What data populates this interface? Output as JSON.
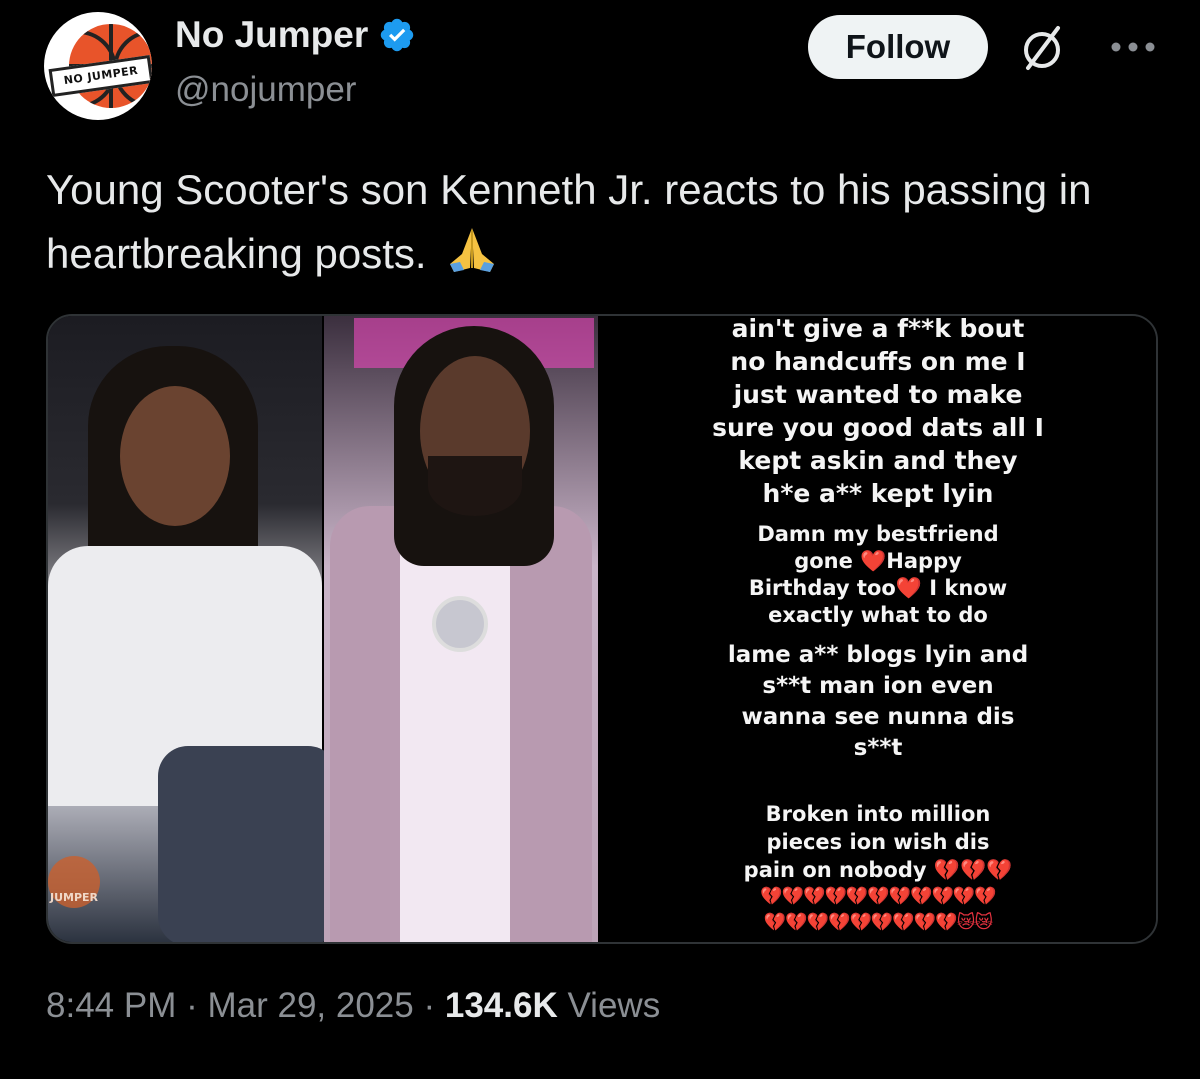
{
  "author": {
    "display_name": "No Jumper",
    "handle": "@nojumper",
    "avatar_text": "NO JUMPER",
    "verified": true
  },
  "actions": {
    "follow_label": "Follow"
  },
  "tweet": {
    "text": "Young Scooter's son Kenneth Jr. reacts to his passing in heartbreaking posts.",
    "emoji": "folded-hands",
    "time": "8:44 PM",
    "separator": "·",
    "date": "Mar 29, 2025",
    "views_count": "134.6K",
    "views_label": "Views"
  },
  "media": {
    "photo1_watermark": "JUMPER",
    "story_block1": [
      "ain't give a f**k bout",
      "no handcuffs on me I",
      "just wanted to make",
      "sure you good dats all I",
      "kept askin and they",
      "h*e a** kept lyin"
    ],
    "story_block2": [
      "Damn my bestfriend",
      "gone ❤️Happy",
      "Birthday too❤️ I know",
      "exactly what to do"
    ],
    "story_block3": [
      "lame a** blogs lyin and",
      "s**t man ion even",
      "wanna see nunna dis",
      "s**t"
    ],
    "story_block4": [
      "Broken into million",
      "pieces ion wish dis",
      "pain on nobody 💔💔💔"
    ],
    "hearts_row1": "💔💔💔💔💔💔💔💔💔💔💔",
    "hearts_row2": "💔💔💔💔💔💔💔💔💔😿😿"
  },
  "colors": {
    "background": "#000000",
    "verified_blue": "#1d9bf0",
    "follow_bg": "#eff3f4",
    "secondary_text": "#8b8f94"
  }
}
